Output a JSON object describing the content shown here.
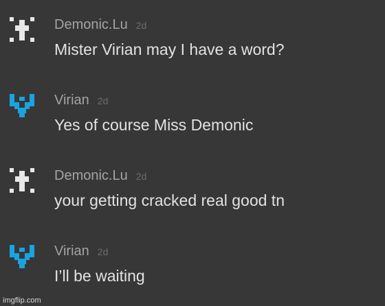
{
  "messages": [
    {
      "username": "Demonic.Lu",
      "time": "2d",
      "text": "Mister Virian may I have a word?",
      "avatar_icon": "pixel-cross-icon",
      "avatar_color": "#e8e8e8"
    },
    {
      "username": "Virian",
      "time": "2d",
      "text": "Yes of course Miss Demonic",
      "avatar_icon": "pixel-v-icon",
      "avatar_color": "#1aa3e0"
    },
    {
      "username": "Demonic.Lu",
      "time": "2d",
      "text": "your getting cracked real good tn",
      "avatar_icon": "pixel-cross-icon",
      "avatar_color": "#e8e8e8"
    },
    {
      "username": "Virian",
      "time": "2d",
      "text": "I’ll be waiting",
      "avatar_icon": "pixel-v-icon",
      "avatar_color": "#1aa3e0"
    }
  ],
  "watermark": "imgflip.com",
  "colors": {
    "background": "#373737",
    "username": "#a4a4a4",
    "timestamp": "#6d6d6d",
    "message_text": "#e2e2e2"
  }
}
